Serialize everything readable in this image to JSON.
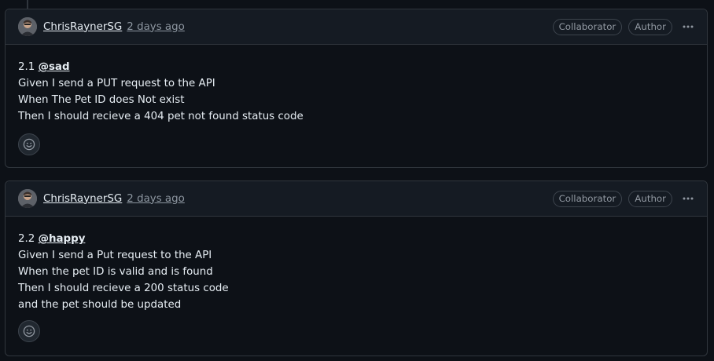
{
  "comments": [
    {
      "author": "ChrisRaynerSG",
      "time": "2 days ago",
      "badges": [
        "Collaborator",
        "Author"
      ],
      "heading_prefix": "2.1",
      "mention": "@sad",
      "lines": [
        "Given I send a PUT request to the API",
        "When The Pet ID does Not exist",
        "Then I should recieve a 404 pet not found status code"
      ]
    },
    {
      "author": "ChrisRaynerSG",
      "time": "2 days ago",
      "badges": [
        "Collaborator",
        "Author"
      ],
      "heading_prefix": "2.2",
      "mention": "@happy",
      "lines": [
        "Given I send a Put request to the API",
        "When the pet ID is valid and is found",
        "Then I should recieve a 200 status code",
        "and the pet should be updated"
      ]
    }
  ],
  "icons": {
    "more": "kebab-horizontal-icon",
    "reaction": "smiley-icon"
  },
  "colors": {
    "background": "#0d1117",
    "header_background": "#151b23",
    "border": "#30363d",
    "text": "#e6edf3",
    "muted": "#8d96a0"
  }
}
